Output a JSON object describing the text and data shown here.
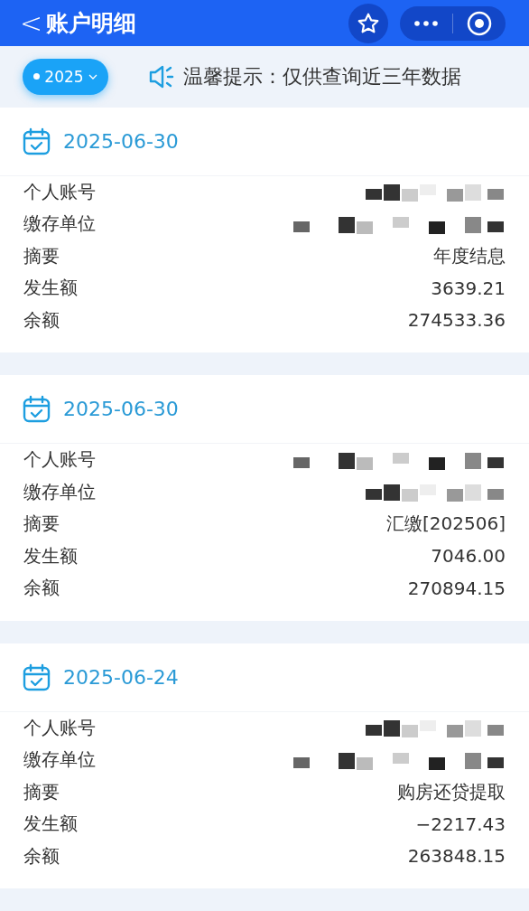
{
  "header": {
    "back": "<",
    "title": "账户明细"
  },
  "filter": {
    "year": "2025",
    "notice": "温馨提示：仅供查询近三年数据"
  },
  "records": [
    {
      "date": "2025-06-30",
      "rows": [
        {
          "label": "个人账号",
          "kind": "redacted"
        },
        {
          "label": "缴存单位",
          "kind": "redacted"
        },
        {
          "label": "摘要",
          "kind": "text",
          "value": "年度结息"
        },
        {
          "label": "发生额",
          "kind": "text",
          "value": "3639.21"
        },
        {
          "label": "余额",
          "kind": "text",
          "value": "274533.36"
        }
      ]
    },
    {
      "date": "2025-06-30",
      "rows": [
        {
          "label": "个人账号",
          "kind": "redacted"
        },
        {
          "label": "缴存单位",
          "kind": "redacted"
        },
        {
          "label": "摘要",
          "kind": "text",
          "value": "汇缴[202506]"
        },
        {
          "label": "发生额",
          "kind": "text",
          "value": "7046.00"
        },
        {
          "label": "余额",
          "kind": "text",
          "value": "270894.15"
        }
      ]
    },
    {
      "date": "2025-06-24",
      "rows": [
        {
          "label": "个人账号",
          "kind": "redacted"
        },
        {
          "label": "缴存单位",
          "kind": "redacted"
        },
        {
          "label": "摘要",
          "kind": "text",
          "value": "购房还贷提取"
        },
        {
          "label": "发生额",
          "kind": "text",
          "value": "−2217.43"
        },
        {
          "label": "余额",
          "kind": "text",
          "value": "263848.15"
        }
      ]
    }
  ]
}
